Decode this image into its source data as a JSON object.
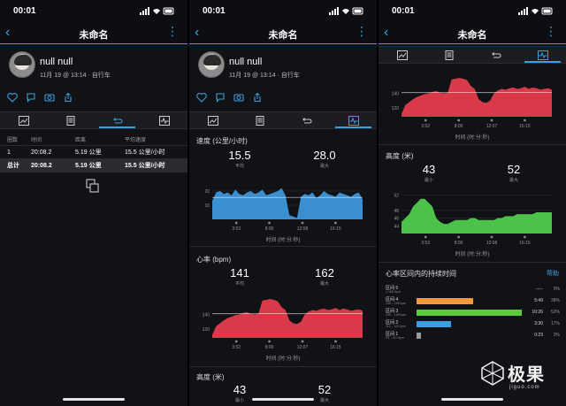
{
  "status": {
    "time": "00:01"
  },
  "nav": {
    "title": "未命名"
  },
  "profile": {
    "name": "null null",
    "meta": "11月 19 @ 13:14 · 自行车"
  },
  "laps": {
    "headers": [
      "圈数",
      "时间",
      "距离",
      "平均速度"
    ],
    "rows": [
      [
        "1",
        "20:08.2",
        "5.19 公里",
        "15.5 公里/小时"
      ]
    ],
    "total": [
      "总计",
      "20:08.2",
      "5.19 公里",
      "15.5 公里/小时"
    ]
  },
  "speed": {
    "title": "速度 (公里/小时)",
    "avg_value": "15.5",
    "avg_label": "平均",
    "max_value": "28.0",
    "max_label": "最大",
    "x_axis_label": "时间 (时:分:秒)",
    "color": "#3a8fd0"
  },
  "heart_rate": {
    "title": "心率 (bpm)",
    "avg_value": "141",
    "avg_label": "平均",
    "max_value": "162",
    "max_label": "最大",
    "x_axis_label": "时间 (时:分:秒)",
    "color": "#d93a4a"
  },
  "elevation": {
    "title": "高度 (米)",
    "min_value": "43",
    "min_label": "最小",
    "max_value": "52",
    "max_label": "最大",
    "x_axis_label": "时间 (时:分:秒)",
    "color": "#4cc24a"
  },
  "zones": {
    "title": "心率区间内的持续时间",
    "help": "帮助",
    "items": [
      {
        "name": "区间 5",
        "range": "> 168 bpm",
        "time": "--:--",
        "percent": "0%",
        "fraction": 0,
        "color": "#d93a4a"
      },
      {
        "name": "区间 4",
        "range": "149 – 168 bpm",
        "time": "5:49",
        "percent": "28%",
        "fraction": 0.28,
        "color": "#f39a3a"
      },
      {
        "name": "区间 3",
        "range": "130 – 148 bpm",
        "time": "10:26",
        "percent": "52%",
        "fraction": 0.52,
        "color": "#5ccc3e"
      },
      {
        "name": "区间 2",
        "range": "112 – 129 bpm",
        "time": "3:30",
        "percent": "17%",
        "fraction": 0.17,
        "color": "#3a9ee0"
      },
      {
        "name": "区间 1",
        "range": "93 – 111 bpm",
        "time": "0:23",
        "percent": "2%",
        "fraction": 0.02,
        "color": "#9a9a9a"
      }
    ]
  },
  "chart_data": [
    {
      "type": "area",
      "ylabel": "速度 (公里/小时)",
      "x": [
        "3:53",
        "8:00",
        "12:08",
        "16:15"
      ],
      "y_ticks": [
        10,
        20
      ],
      "ylim": [
        0,
        30
      ],
      "series": [
        {
          "values": [
            13,
            19,
            20,
            18,
            19,
            17,
            21,
            18,
            17,
            19,
            20,
            18,
            19,
            21,
            17,
            18,
            19,
            20,
            22,
            17,
            3,
            2,
            1,
            16,
            18,
            17,
            19,
            15,
            17,
            20,
            18,
            17,
            16,
            19,
            18,
            17,
            16,
            18,
            19,
            14
          ]
        }
      ]
    },
    {
      "type": "area",
      "ylabel": "心率 (bpm)",
      "x": [
        "3:52",
        "8:00",
        "12:07",
        "16:15"
      ],
      "y_ticks": [
        120,
        140
      ],
      "ylim": [
        108,
        166
      ],
      "series": [
        {
          "values": [
            112,
            124,
            128,
            132,
            135,
            137,
            139,
            140,
            142,
            143,
            141,
            140,
            141,
            159,
            160,
            161,
            160,
            158,
            150,
            146,
            132,
            128,
            127,
            130,
            140,
            144,
            146,
            145,
            147,
            148,
            146,
            147,
            149,
            146,
            148,
            147,
            145,
            146,
            147,
            145
          ]
        }
      ]
    },
    {
      "type": "area",
      "ylabel": "高度 (米)",
      "x": [
        "3:53",
        "8:00",
        "12:08",
        "16:15"
      ],
      "y_ticks": [
        44,
        46,
        48,
        52
      ],
      "ylim": [
        42,
        53
      ],
      "series": [
        {
          "values": [
            45,
            46,
            47,
            49,
            50,
            51,
            51,
            50,
            49,
            46,
            45,
            44.5,
            44.5,
            45,
            45.5,
            45.5,
            45.5,
            45.5,
            46,
            46,
            45.5,
            45.5,
            45.5,
            45.5,
            45.5,
            46,
            46,
            46.5,
            46.5,
            46.5,
            47,
            47,
            47,
            47,
            47,
            47.5,
            47.5,
            47.5,
            47.5,
            47.5
          ]
        }
      ]
    }
  ],
  "watermark": {
    "brand": "极果",
    "sub": "jiguo.com"
  }
}
